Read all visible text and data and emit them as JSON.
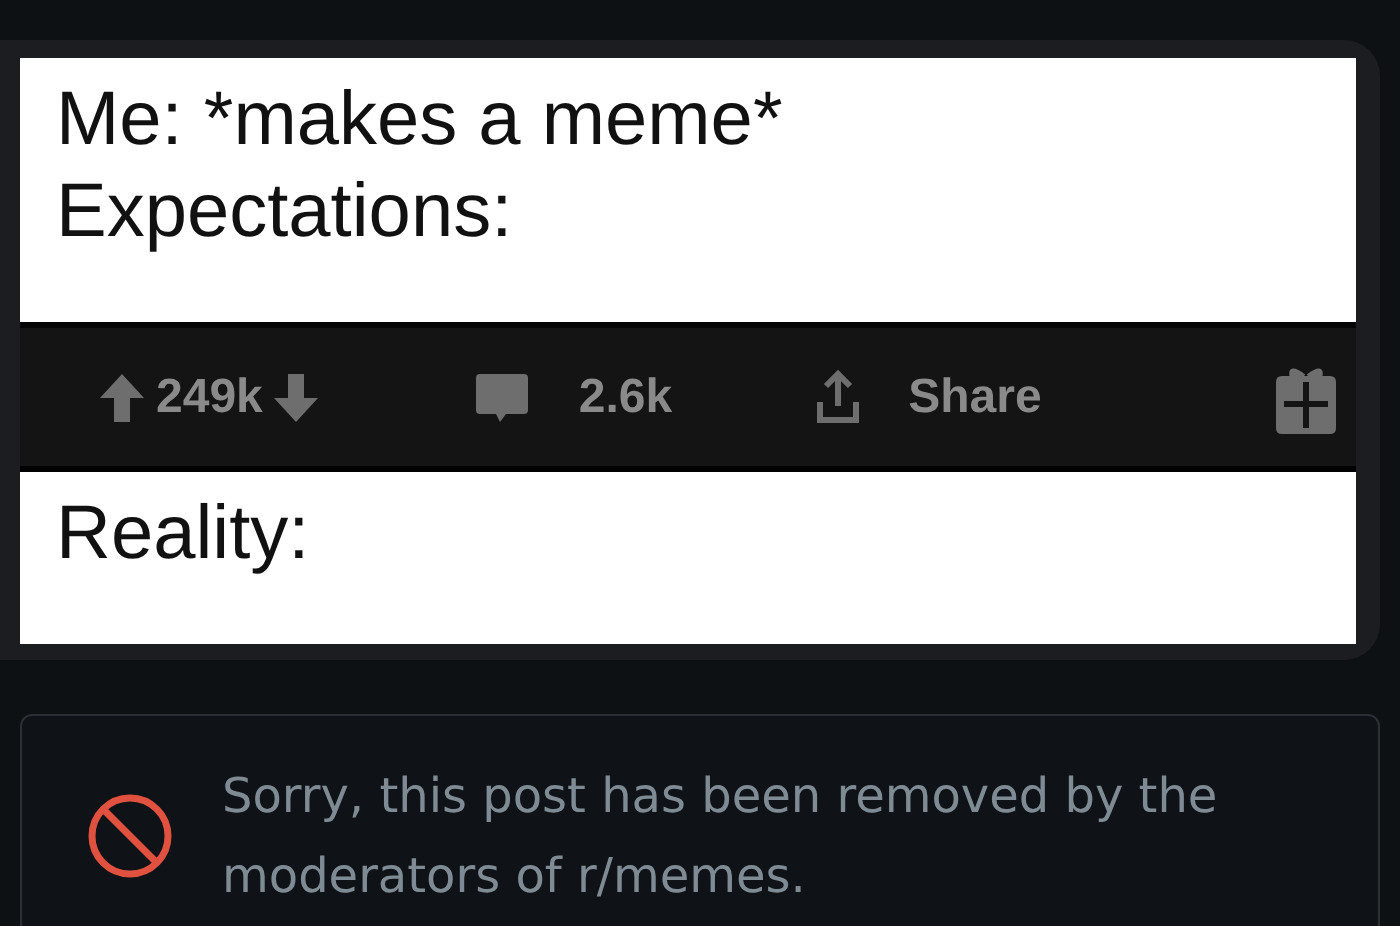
{
  "meme": {
    "top_lines": [
      "Me: *makes a meme*",
      "Expectations:"
    ],
    "action_bar": {
      "upvotes": "249k",
      "comments": "2.6k",
      "share": "Share"
    },
    "bottom_line": "Reality:"
  },
  "removed_notice": {
    "message": "Sorry, this post has been removed by the moderators of r/memes."
  }
}
